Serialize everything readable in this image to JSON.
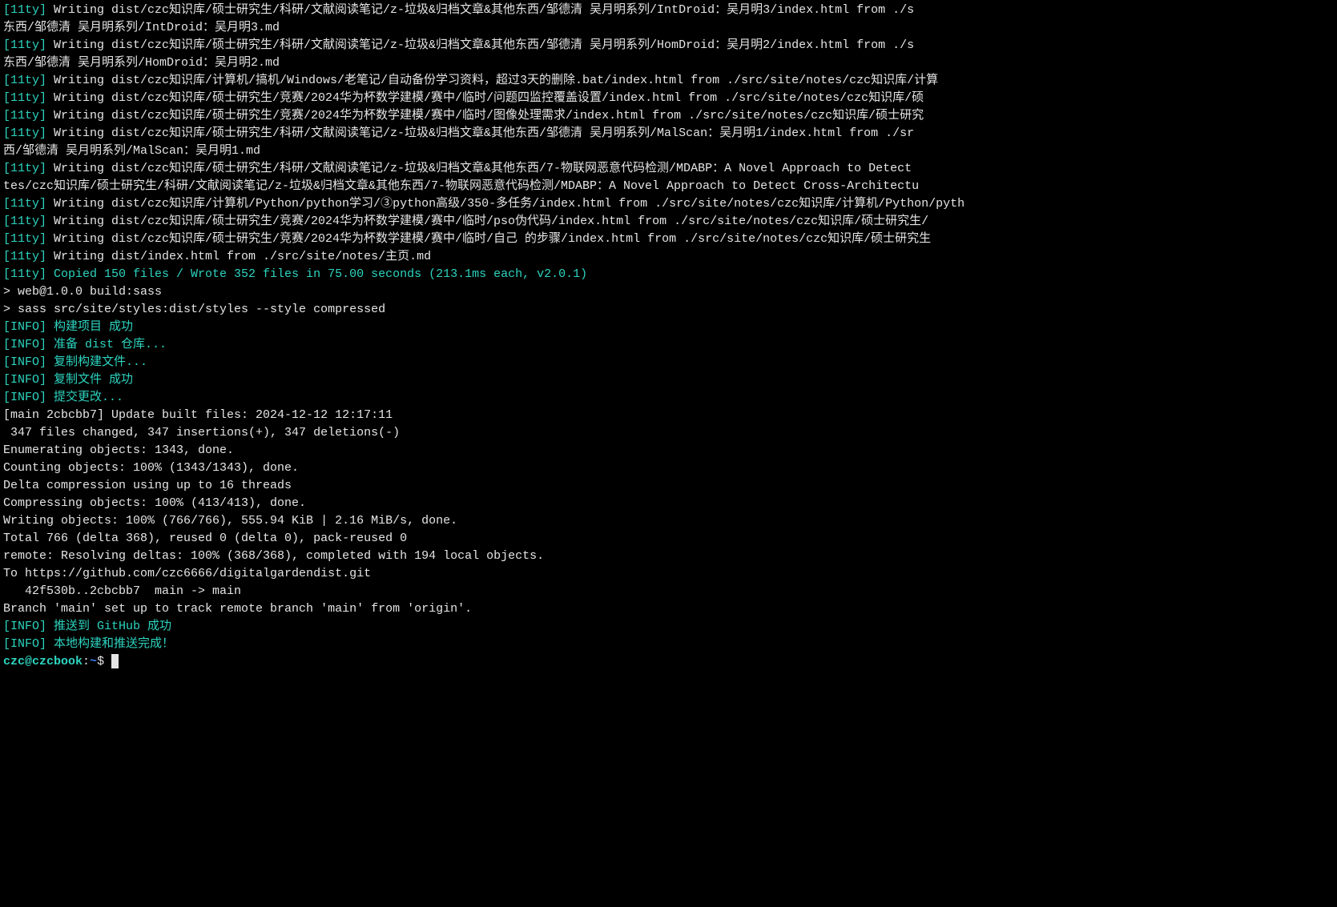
{
  "lines": [
    {
      "segments": [
        {
          "cls": "cyan",
          "text": "[11ty] "
        },
        {
          "cls": "white",
          "text": "Writing dist/czc知识库/硕士研究生/科研/文献阅读笔记/z-垃圾&归档文章&其他东西/邹德清 吴月明系列/IntDroid：吴月明3/index.html from ./s"
        }
      ]
    },
    {
      "segments": [
        {
          "cls": "white",
          "text": "东西/邹德清 吴月明系列/IntDroid：吴月明3.md"
        }
      ]
    },
    {
      "segments": [
        {
          "cls": "cyan",
          "text": "[11ty] "
        },
        {
          "cls": "white",
          "text": "Writing dist/czc知识库/硕士研究生/科研/文献阅读笔记/z-垃圾&归档文章&其他东西/邹德清 吴月明系列/HomDroid：吴月明2/index.html from ./s"
        }
      ]
    },
    {
      "segments": [
        {
          "cls": "white",
          "text": "东西/邹德清 吴月明系列/HomDroid：吴月明2.md"
        }
      ]
    },
    {
      "segments": [
        {
          "cls": "cyan",
          "text": "[11ty] "
        },
        {
          "cls": "white",
          "text": "Writing dist/czc知识库/计算机/搞机/Windows/老笔记/自动备份学习资料，超过3天的删除.bat/index.html from ./src/site/notes/czc知识库/计算"
        }
      ]
    },
    {
      "segments": [
        {
          "cls": "cyan",
          "text": "[11ty] "
        },
        {
          "cls": "white",
          "text": "Writing dist/czc知识库/硕士研究生/竞赛/2024华为杯数学建模/赛中/临时/问题四监控覆盖设置/index.html from ./src/site/notes/czc知识库/硕"
        }
      ]
    },
    {
      "segments": [
        {
          "cls": "cyan",
          "text": "[11ty] "
        },
        {
          "cls": "white",
          "text": "Writing dist/czc知识库/硕士研究生/竞赛/2024华为杯数学建模/赛中/临时/图像处理需求/index.html from ./src/site/notes/czc知识库/硕士研究"
        }
      ]
    },
    {
      "segments": [
        {
          "cls": "cyan",
          "text": "[11ty] "
        },
        {
          "cls": "white",
          "text": "Writing dist/czc知识库/硕士研究生/科研/文献阅读笔记/z-垃圾&归档文章&其他东西/邹德清 吴月明系列/MalScan：吴月明1/index.html from ./sr"
        }
      ]
    },
    {
      "segments": [
        {
          "cls": "white",
          "text": "西/邹德清 吴月明系列/MalScan：吴月明1.md"
        }
      ]
    },
    {
      "segments": [
        {
          "cls": "cyan",
          "text": "[11ty] "
        },
        {
          "cls": "white",
          "text": "Writing dist/czc知识库/硕士研究生/科研/文献阅读笔记/z-垃圾&归档文章&其他东西/7-物联网恶意代码检测/MDABP：A Novel Approach to Detect "
        }
      ]
    },
    {
      "segments": [
        {
          "cls": "white",
          "text": "tes/czc知识库/硕士研究生/科研/文献阅读笔记/z-垃圾&归档文章&其他东西/7-物联网恶意代码检测/MDABP：A Novel Approach to Detect Cross-Architectu"
        }
      ]
    },
    {
      "segments": [
        {
          "cls": "cyan",
          "text": "[11ty] "
        },
        {
          "cls": "white",
          "text": "Writing dist/czc知识库/计算机/Python/python学习/③python高级/350-多任务/index.html from ./src/site/notes/czc知识库/计算机/Python/pyth"
        }
      ]
    },
    {
      "segments": [
        {
          "cls": "cyan",
          "text": "[11ty] "
        },
        {
          "cls": "white",
          "text": "Writing dist/czc知识库/硕士研究生/竞赛/2024华为杯数学建模/赛中/临时/pso伪代码/index.html from ./src/site/notes/czc知识库/硕士研究生/"
        }
      ]
    },
    {
      "segments": [
        {
          "cls": "cyan",
          "text": "[11ty] "
        },
        {
          "cls": "white",
          "text": "Writing dist/czc知识库/硕士研究生/竞赛/2024华为杯数学建模/赛中/临时/自己 的步骤/index.html from ./src/site/notes/czc知识库/硕士研究生"
        }
      ]
    },
    {
      "segments": [
        {
          "cls": "cyan",
          "text": "[11ty] "
        },
        {
          "cls": "white",
          "text": "Writing dist/index.html from ./src/site/notes/主页.md"
        }
      ]
    },
    {
      "segments": [
        {
          "cls": "cyan",
          "text": "[11ty] Copied 150 files / Wrote 352 files in 75.00 seconds (213.1ms each, v2.0.1)"
        }
      ]
    },
    {
      "segments": [
        {
          "cls": "white",
          "text": ""
        }
      ]
    },
    {
      "segments": [
        {
          "cls": "white",
          "text": "> web@1.0.0 build:sass"
        }
      ]
    },
    {
      "segments": [
        {
          "cls": "white",
          "text": "> sass src/site/styles:dist/styles --style compressed"
        }
      ]
    },
    {
      "segments": [
        {
          "cls": "white",
          "text": ""
        }
      ]
    },
    {
      "segments": [
        {
          "cls": "green",
          "text": "[INFO] 构建项目 成功"
        }
      ]
    },
    {
      "segments": [
        {
          "cls": "green",
          "text": "[INFO] 准备 dist 仓库..."
        }
      ]
    },
    {
      "segments": [
        {
          "cls": "green",
          "text": "[INFO] 复制构建文件..."
        }
      ]
    },
    {
      "segments": [
        {
          "cls": "green",
          "text": "[INFO] 复制文件 成功"
        }
      ]
    },
    {
      "segments": [
        {
          "cls": "green",
          "text": "[INFO] 提交更改..."
        }
      ]
    },
    {
      "segments": [
        {
          "cls": "white",
          "text": "[main 2cbcbb7] Update built files: 2024-12-12 12:17:11"
        }
      ]
    },
    {
      "segments": [
        {
          "cls": "white",
          "text": " 347 files changed, 347 insertions(+), 347 deletions(-)"
        }
      ]
    },
    {
      "segments": [
        {
          "cls": "white",
          "text": "Enumerating objects: 1343, done."
        }
      ]
    },
    {
      "segments": [
        {
          "cls": "white",
          "text": "Counting objects: 100% (1343/1343), done."
        }
      ]
    },
    {
      "segments": [
        {
          "cls": "white",
          "text": "Delta compression using up to 16 threads"
        }
      ]
    },
    {
      "segments": [
        {
          "cls": "white",
          "text": "Compressing objects: 100% (413/413), done."
        }
      ]
    },
    {
      "segments": [
        {
          "cls": "white",
          "text": "Writing objects: 100% (766/766), 555.94 KiB | 2.16 MiB/s, done."
        }
      ]
    },
    {
      "segments": [
        {
          "cls": "white",
          "text": "Total 766 (delta 368), reused 0 (delta 0), pack-reused 0"
        }
      ]
    },
    {
      "segments": [
        {
          "cls": "white",
          "text": "remote: Resolving deltas: 100% (368/368), completed with 194 local objects."
        }
      ]
    },
    {
      "segments": [
        {
          "cls": "white",
          "text": "To https://github.com/czc6666/digitalgardendist.git"
        }
      ]
    },
    {
      "segments": [
        {
          "cls": "white",
          "text": "   42f530b..2cbcbb7  main -> main"
        }
      ]
    },
    {
      "segments": [
        {
          "cls": "white",
          "text": "Branch 'main' set up to track remote branch 'main' from 'origin'."
        }
      ]
    },
    {
      "segments": [
        {
          "cls": "green",
          "text": "[INFO] 推送到 GitHub 成功"
        }
      ]
    },
    {
      "segments": [
        {
          "cls": "green",
          "text": "[INFO] 本地构建和推送完成！"
        }
      ]
    }
  ],
  "prompt": {
    "user": "czc@czcbook",
    "sep": ":",
    "path": "~",
    "dollar": "$ "
  }
}
